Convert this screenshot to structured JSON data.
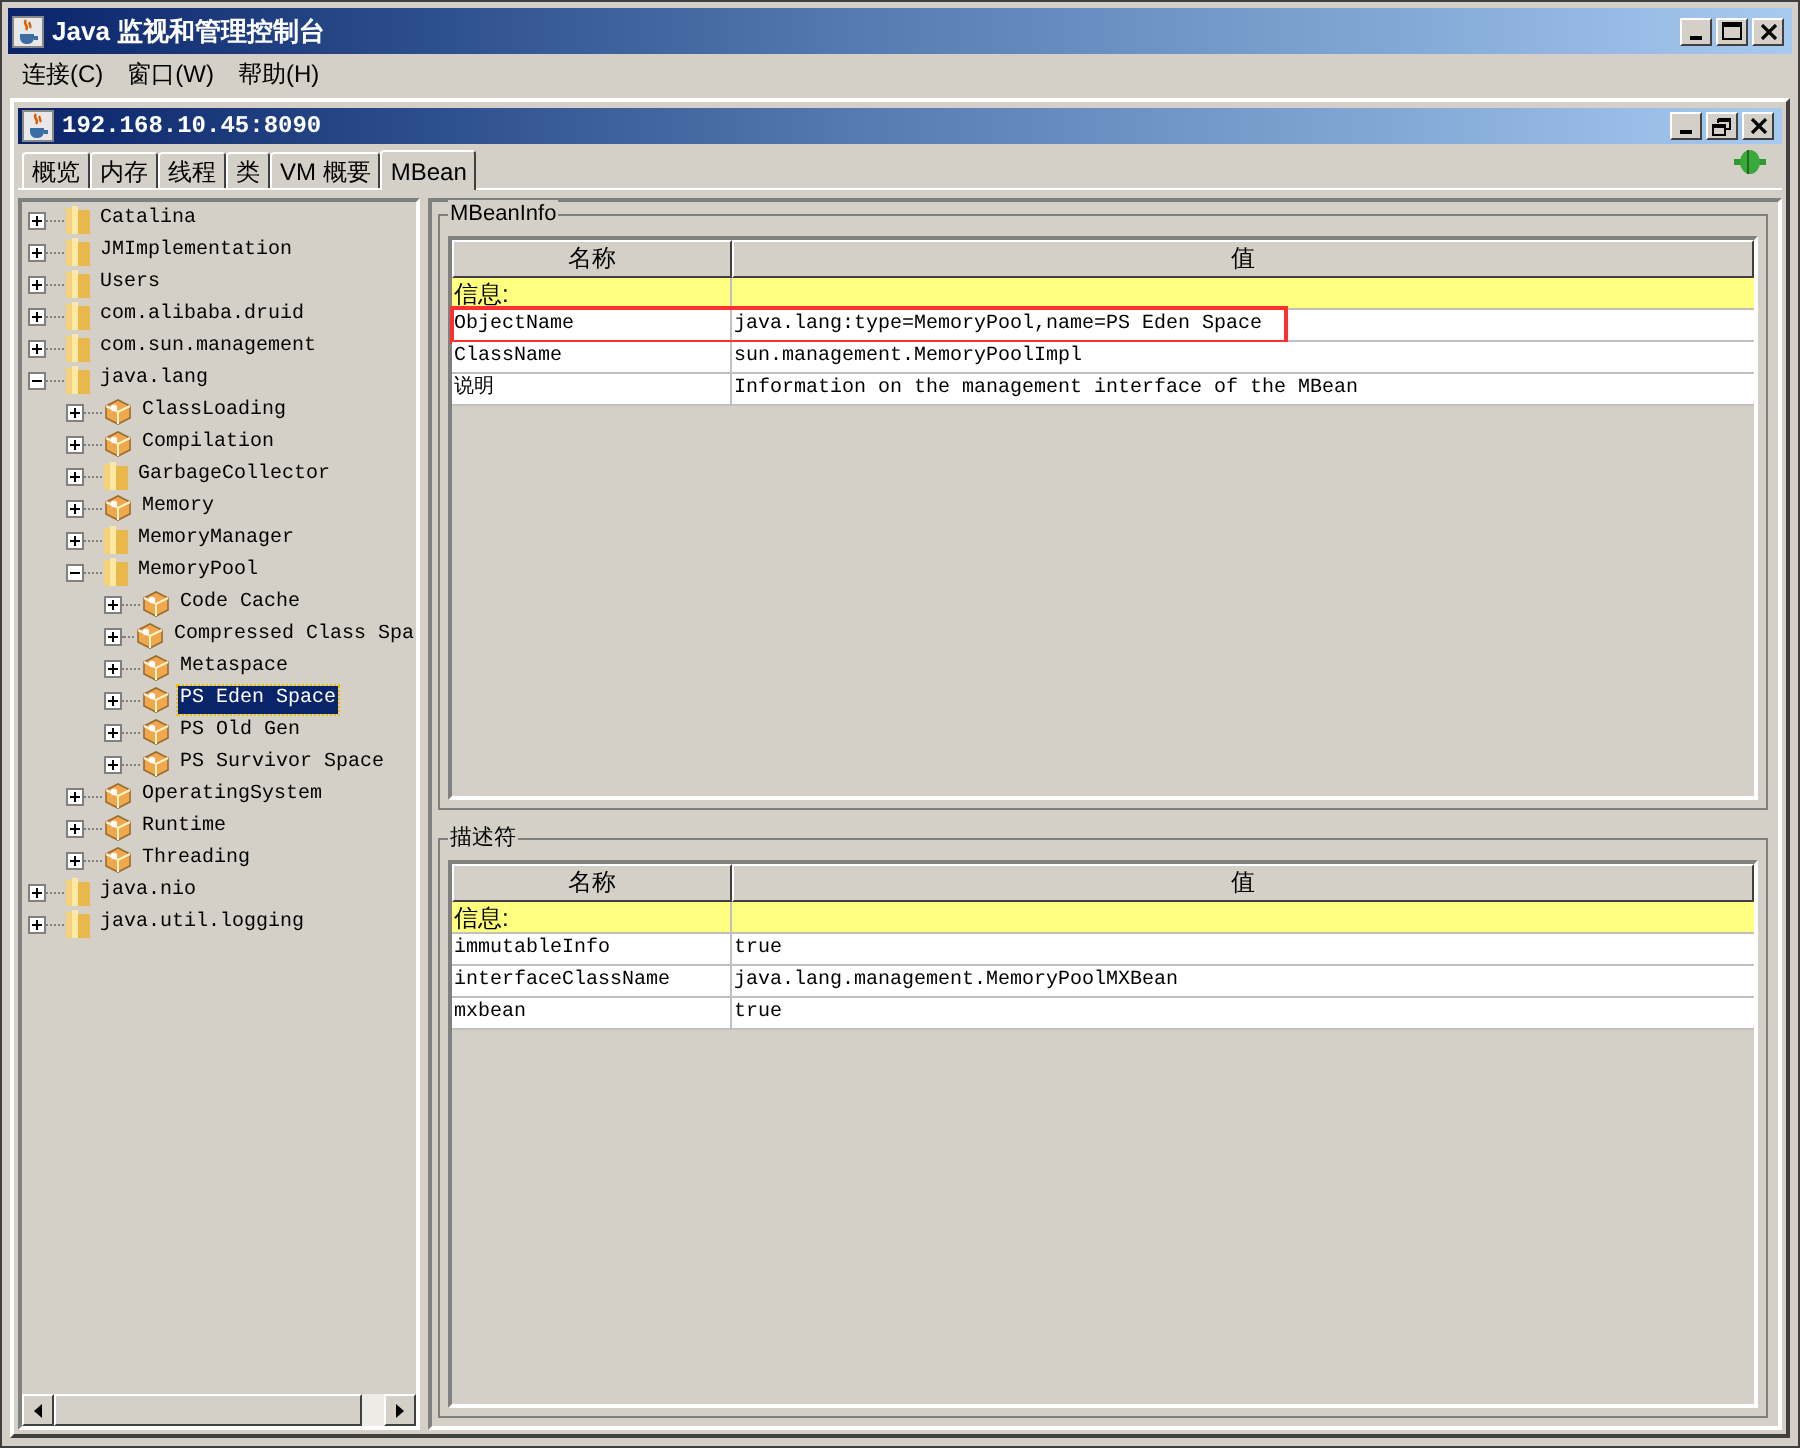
{
  "window": {
    "title": "Java 监视和管理控制台"
  },
  "menu": [
    "连接(C)",
    "窗口(W)",
    "帮助(H)"
  ],
  "connection": {
    "title": "192.168.10.45:8090"
  },
  "tabs": [
    {
      "label": "概览",
      "selected": false
    },
    {
      "label": "内存",
      "selected": false
    },
    {
      "label": "线程",
      "selected": false
    },
    {
      "label": "类",
      "selected": false
    },
    {
      "label": "VM 概要",
      "selected": false
    },
    {
      "label": "MBean",
      "selected": true
    }
  ],
  "tree": [
    {
      "label": "Catalina",
      "kind": "folder",
      "expanded": false,
      "selected": false
    },
    {
      "label": "JMImplementation",
      "kind": "folder",
      "expanded": false,
      "selected": false
    },
    {
      "label": "Users",
      "kind": "folder",
      "expanded": false,
      "selected": false
    },
    {
      "label": "com.alibaba.druid",
      "kind": "folder",
      "expanded": false,
      "selected": false
    },
    {
      "label": "com.sun.management",
      "kind": "folder",
      "expanded": false,
      "selected": false
    },
    {
      "label": "java.lang",
      "kind": "folder",
      "expanded": true,
      "selected": false,
      "children": [
        {
          "label": "ClassLoading",
          "kind": "bean",
          "expanded": false,
          "selected": false
        },
        {
          "label": "Compilation",
          "kind": "bean",
          "expanded": false,
          "selected": false
        },
        {
          "label": "GarbageCollector",
          "kind": "folder",
          "expanded": false,
          "selected": false
        },
        {
          "label": "Memory",
          "kind": "bean",
          "expanded": false,
          "selected": false
        },
        {
          "label": "MemoryManager",
          "kind": "folder",
          "expanded": false,
          "selected": false
        },
        {
          "label": "MemoryPool",
          "kind": "folder",
          "expanded": true,
          "selected": false,
          "children": [
            {
              "label": "Code Cache",
              "kind": "bean",
              "expanded": false,
              "selected": false
            },
            {
              "label": "Compressed Class Spa",
              "kind": "bean",
              "expanded": false,
              "selected": false
            },
            {
              "label": "Metaspace",
              "kind": "bean",
              "expanded": false,
              "selected": false
            },
            {
              "label": "PS Eden Space",
              "kind": "bean",
              "expanded": false,
              "selected": true
            },
            {
              "label": "PS Old Gen",
              "kind": "bean",
              "expanded": false,
              "selected": false
            },
            {
              "label": "PS Survivor Space",
              "kind": "bean",
              "expanded": false,
              "selected": false
            }
          ]
        },
        {
          "label": "OperatingSystem",
          "kind": "bean",
          "expanded": false,
          "selected": false
        },
        {
          "label": "Runtime",
          "kind": "bean",
          "expanded": false,
          "selected": false
        },
        {
          "label": "Threading",
          "kind": "bean",
          "expanded": false,
          "selected": false
        }
      ]
    },
    {
      "label": "java.nio",
      "kind": "folder",
      "expanded": false,
      "selected": false
    },
    {
      "label": "java.util.logging",
      "kind": "folder",
      "expanded": false,
      "selected": false
    }
  ],
  "panels": [
    {
      "title": "MBeanInfo",
      "columns": [
        "名称",
        "值"
      ],
      "rows": [
        {
          "kind": "group",
          "cells": [
            "信息:"
          ],
          "highlighted": false
        },
        {
          "kind": "row",
          "cells": [
            "ObjectName",
            "java.lang:type=MemoryPool,name=PS Eden Space"
          ],
          "highlighted": true
        },
        {
          "kind": "row",
          "cells": [
            "ClassName",
            "sun.management.MemoryPoolImpl"
          ],
          "highlighted": false
        },
        {
          "kind": "row",
          "cells": [
            "说明",
            "Information on the management interface of the MBean"
          ],
          "highlighted": false
        }
      ]
    },
    {
      "title": "描述符",
      "columns": [
        "名称",
        "值"
      ],
      "rows": [
        {
          "kind": "group",
          "cells": [
            "信息:"
          ],
          "highlighted": false
        },
        {
          "kind": "row",
          "cells": [
            "immutableInfo",
            "true"
          ],
          "highlighted": false
        },
        {
          "kind": "row",
          "cells": [
            "interfaceClassName",
            "java.lang.management.MemoryPoolMXBean"
          ],
          "highlighted": false
        },
        {
          "kind": "row",
          "cells": [
            "mxbean",
            "true"
          ],
          "highlighted": false
        }
      ]
    }
  ]
}
